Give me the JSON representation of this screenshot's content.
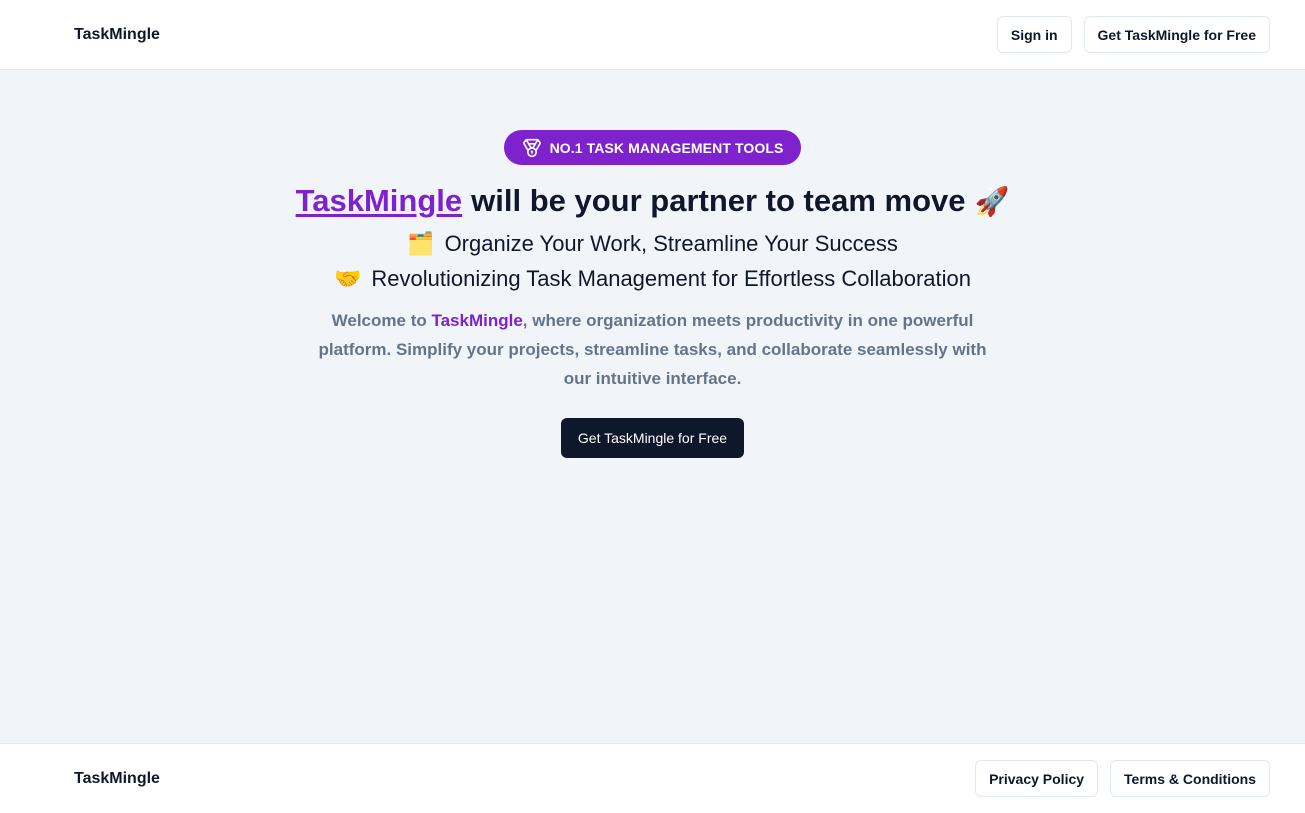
{
  "header": {
    "brand": "TaskMingle",
    "sign_in_label": "Sign in",
    "cta_label": "Get TaskMingle for Free"
  },
  "hero": {
    "badge_icon": "medal-icon",
    "badge_text": "NO.1 TASK MANAGEMENT TOOLS",
    "headline_link": "TaskMingle",
    "headline_rest": "will be your partner to team move",
    "headline_emoji": "🚀",
    "subline1_emoji": "🗂️",
    "subline1_text": "Organize Your Work, Streamline Your Success",
    "subline2_emoji": "🤝",
    "subline2_text": "Revolutionizing Task Management for Effortless Collaboration",
    "desc_prefix": "Welcome to ",
    "desc_highlight": "TaskMingle",
    "desc_suffix": ", where organization meets productivity in one powerful platform. Simplify your projects, streamline tasks, and collaborate seamlessly with our intuitive interface.",
    "cta_label": "Get TaskMingle for Free"
  },
  "footer": {
    "brand": "TaskMingle",
    "privacy_label": "Privacy Policy",
    "terms_label": "Terms & Conditions"
  },
  "colors": {
    "accent": "#7e22ce",
    "dark": "#0f172a",
    "muted": "#64748b",
    "hero_bg": "#f1f5f9",
    "border": "#e2e8f0"
  }
}
